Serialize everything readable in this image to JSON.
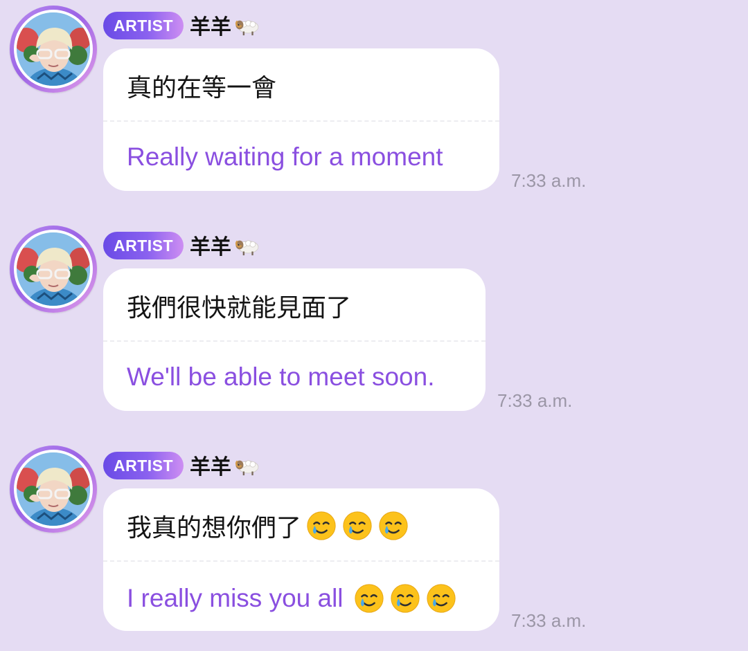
{
  "colors": {
    "background": "#e5dcf3",
    "bubble": "#ffffff",
    "translation_text": "#8a4fe0",
    "badge_gradient_start": "#6a4be6",
    "badge_gradient_end": "#cd8ef2",
    "timestamp": "#9b96a6"
  },
  "messages": [
    {
      "badge": "ARTIST",
      "sender": "羊羊",
      "sender_emoji": "ram-emoji",
      "original": "真的在等一會",
      "translation": "Really waiting for a moment",
      "time": "7:33 a.m."
    },
    {
      "badge": "ARTIST",
      "sender": "羊羊",
      "sender_emoji": "ram-emoji",
      "original": "我們很快就能見面了",
      "translation": "We'll be able to meet soon.",
      "time": "7:33 a.m."
    },
    {
      "badge": "ARTIST",
      "sender": "羊羊",
      "sender_emoji": "ram-emoji",
      "original": "我真的想你們了",
      "original_emojis": [
        "smiling-face-with-tear-icon",
        "smiling-face-with-tear-icon",
        "smiling-face-with-tear-icon"
      ],
      "translation": "I really miss you all",
      "translation_emojis": [
        "smiling-face-with-tear-icon",
        "smiling-face-with-tear-icon",
        "smiling-face-with-tear-icon"
      ],
      "time": "7:33 a.m."
    }
  ]
}
